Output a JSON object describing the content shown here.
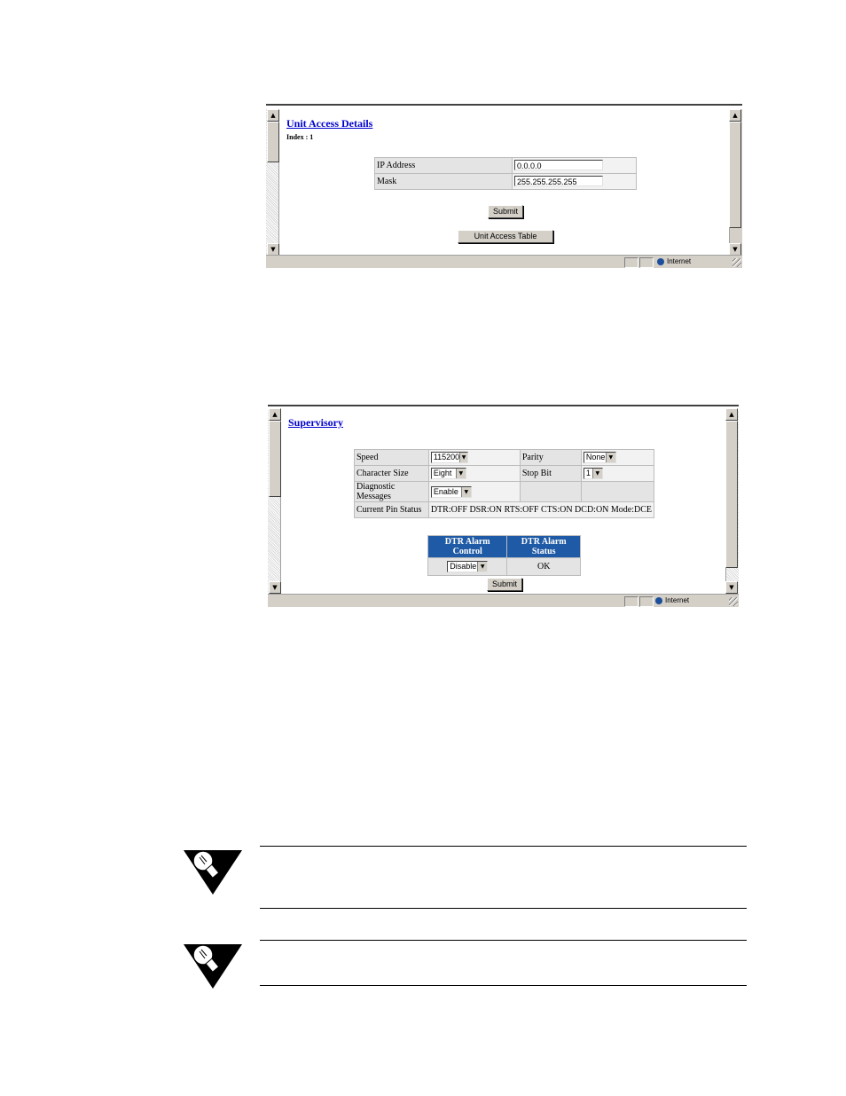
{
  "window1": {
    "title": "Unit Access Details",
    "index_label": "Index : 1",
    "fields": [
      {
        "label": "IP Address",
        "value": "0.0.0.0"
      },
      {
        "label": "Mask",
        "value": "255.255.255.255"
      }
    ],
    "submit_label": "Submit",
    "table_button_label": "Unit Access Table",
    "status_zone": "Internet"
  },
  "window2": {
    "title": "Supervisory",
    "rows": [
      {
        "label1": "Speed",
        "value1": "115200",
        "label2": "Parity",
        "value2": "None"
      },
      {
        "label1": "Character Size",
        "value1": "Eight",
        "label2": "Stop Bit",
        "value2": "1"
      },
      {
        "label1": "Diagnostic Messages",
        "value1": "Enable"
      }
    ],
    "pin_status_label": "Current Pin Status",
    "pin_status_value": "DTR:OFF DSR:ON RTS:OFF CTS:ON DCD:ON Mode:DCE",
    "dtr_control_header": "DTR Alarm Control",
    "dtr_status_header": "DTR Alarm Status",
    "dtr_control_value": "Disable",
    "dtr_status_value": "OK",
    "submit_label": "Submit",
    "status_zone": "Internet"
  },
  "colors": {
    "link": "#0000cc",
    "header_blue": "#1f5aa6",
    "chrome": "#d4d0c8"
  },
  "icons": [
    "scroll-up-arrow-icon",
    "scroll-down-arrow-icon",
    "dropdown-arrow-icon",
    "globe-icon",
    "lightbulb-tip-icon"
  ]
}
